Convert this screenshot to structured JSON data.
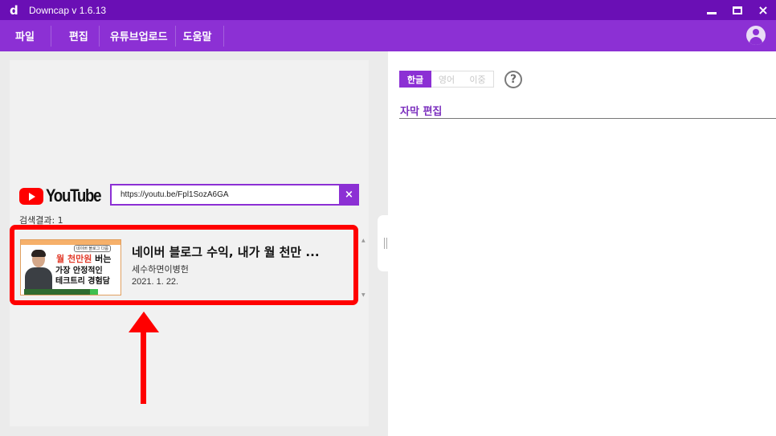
{
  "window": {
    "title": "Downcap v 1.6.13",
    "logo_letter": "d",
    "controls": {
      "minimize": "minimize",
      "maximize": "maximize",
      "close": "×"
    }
  },
  "menu": {
    "items": [
      "파일",
      "편집",
      "유튜브업로드",
      "도움말"
    ]
  },
  "search": {
    "brand": "YouTube",
    "url_value": "https://youtu.be/Fpl1SozA6GA",
    "clear_label": "×",
    "result_count_text": "검색결과: 1"
  },
  "results": [
    {
      "title": "네이버 블로그 수익, 내가 월 천만 ...",
      "channel": "세수하면이병헌",
      "date": "2021. 1. 22.",
      "thumbnail": {
        "tag": "네이버 블로그 다룹",
        "line1_red": "월 천만원",
        "line1_rest": " 버는",
        "line2": "가장 안정적인",
        "line3": "테크트리 경험담"
      }
    }
  ],
  "editor": {
    "lang_tabs": [
      "한글",
      "영어",
      "이중"
    ],
    "active_tab": "한글",
    "help_label": "?",
    "section_title": "자막 편집"
  },
  "colors": {
    "titlebar": "#6a0fb5",
    "menubar": "#8c30d4",
    "accent": "#8c30d4",
    "annotation": "#ff0000"
  }
}
